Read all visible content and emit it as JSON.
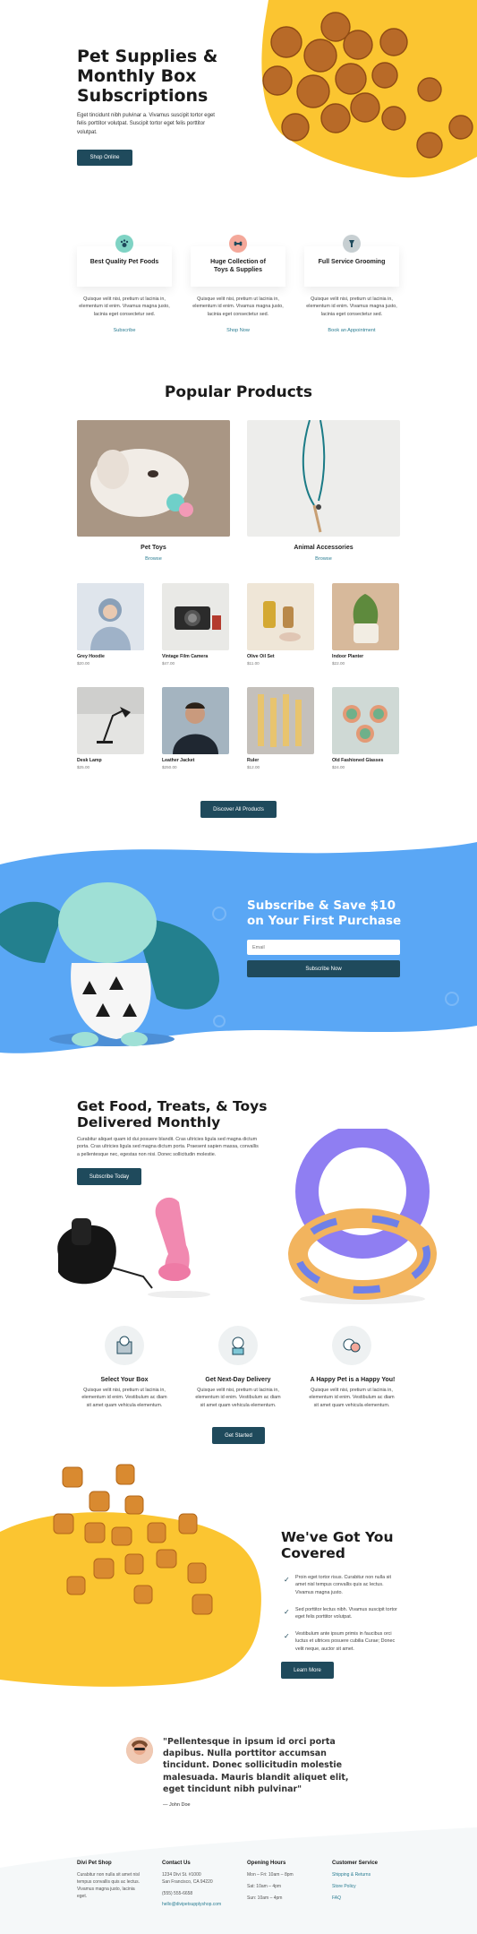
{
  "hero": {
    "title_l1": "Pet Supplies &",
    "title_l2": "Monthly Box",
    "title_l3": "Subscriptions",
    "body": "Eget tincidunt nibh pulvinar a. Vivamus suscipit tortor eget felis porttitor volutpat. Suscipit tortor eget felis porttitor volutpat.",
    "button": "Shop Online"
  },
  "features": [
    {
      "title": "Best Quality Pet Foods",
      "text": "Quisque velit nisi, pretium ut lacinia in, elementum id enim. Vivamus magna justo, lacinia eget consectetur sed.",
      "link": "Subscribe",
      "color": "#7fd3c4",
      "icon": "paw-icon"
    },
    {
      "title": "Huge Collection of Toys & Supplies",
      "text": "Quisque velit nisi, pretium ut lacinia in, elementum id enim. Vivamus magna justo, lacinia eget consectetur sed.",
      "link": "Shop Now",
      "color": "#f4a89a",
      "icon": "bone-icon"
    },
    {
      "title": "Full Service Grooming",
      "text": "Quisque velit nisi, pretium ut lacinia in, elementum id enim. Vivamus magna justo, lacinia eget consectetur sed.",
      "link": "Book an Appointment",
      "color": "#b9c4c8",
      "icon": "scissors-icon"
    }
  ],
  "popular": {
    "title": "Popular Products",
    "cat1": {
      "name": "Pet Toys",
      "link": "Browse"
    },
    "cat2": {
      "name": "Animal Accessories",
      "link": "Browse"
    },
    "button": "Discover All Products"
  },
  "products": [
    {
      "name": "Grey Hoodie",
      "price": "$20.00",
      "color": "#b7c4d6"
    },
    {
      "name": "Vintage Film Camera",
      "price": "$47.00",
      "color": "#d6d6d2"
    },
    {
      "name": "Olive Oil Set",
      "price": "$11.00",
      "color": "#e4c98d"
    },
    {
      "name": "Indoor Planter",
      "price": "$22.00",
      "color": "#a9a56e"
    },
    {
      "name": "Desk Lamp",
      "price": "$25.00",
      "color": "#bfbfbf"
    },
    {
      "name": "Leather Jacket",
      "price": "$250.00",
      "color": "#34404d"
    },
    {
      "name": "Ruler",
      "price": "$12.00",
      "color": "#d9c3a2"
    },
    {
      "name": "Old Fashioned Glasses",
      "price": "$24.00",
      "color": "#c7d4cf"
    }
  ],
  "subscribe": {
    "title_l1": "Subscribe & Save $10",
    "title_l2": "on Your First Purchase",
    "placeholder": "Email",
    "button": "Subscribe Now"
  },
  "monthly": {
    "title_l1": "Get Food, Treats, & Toys",
    "title_l2": "Delivered Monthly",
    "body": "Curabitur aliquet quam id dui posuere blandit. Cras ultricies ligula sed magna dictum porta. Cras ultricies ligula sed magna dictum porta. Praesent sapien massa, convallis a pellentesque nec, egestas non nisi. Donec sollicitudin molestie.",
    "button": "Subscribe Today"
  },
  "steps": [
    {
      "title": "Select Your Box",
      "text": "Quisque velit nisi, pretium ut lacinia in, elementum id enim. Vestibulum ac diam sit amet quam vehicula elementum."
    },
    {
      "title": "Get Next-Day Delivery",
      "text": "Quisque velit nisi, pretium ut lacinia in, elementum id enim. Vestibulum ac diam sit amet quam vehicula elementum."
    },
    {
      "title": "A Happy Pet is a Happy You!",
      "text": "Quisque velit nisi, pretium ut lacinia in, elementum id enim. Vestibulum ac diam sit amet quam vehicula elementum."
    }
  ],
  "steps_button": "Get Started",
  "covered": {
    "title_l1": "We've Got You",
    "title_l2": "Covered",
    "items": [
      "Proin eget tortor risus. Curabitur non nulla sit amet nisl tempus convallis quis ac lectus. Vivamus magna justo.",
      "Sed porttitor lectus nibh. Vivamus suscipit tortor eget felis porttitor volutpat.",
      "Vestibulum ante ipsum primis in faucibus orci luctus et ultrices posuere cubilia Curae; Donec velit neque, auctor sit amet."
    ],
    "button": "Learn More"
  },
  "testimonial": {
    "quote": "\"Pellentesque in ipsum id orci porta dapibus. Nulla porttitor accumsan tincidunt. Donec sollicitudin molestie malesuada. Mauris blandit aliquet elit, eget tincidunt nibh pulvinar\"",
    "author": "— John Doe"
  },
  "footer": {
    "col1": {
      "title": "Divi Pet Shop",
      "text": "Curabitur non nulla sit amet nisl tempus convallis quis ac lectus. Vivamus magna justo, lacinia eget."
    },
    "col2": {
      "title": "Contact Us",
      "l1": "1234 Divi St. #1000",
      "l2": "San Francisco, CA 94220",
      "l3": "(555) 555-6658",
      "l4": "hello@divipetsupplyshop.com"
    },
    "col3": {
      "title": "Opening Hours",
      "l1": "Mon – Fri: 10am – 8pm",
      "l2": "Sat: 10am – 4pm",
      "l3": "Sun: 10am – 4pm"
    },
    "col4": {
      "title": "Customer Service",
      "l1": "Shipping & Returns",
      "l2": "Store Policy",
      "l3": "FAQ"
    }
  },
  "colors": {
    "accent": "#1f4a5c",
    "yellow": "#fbc531",
    "blue": "#5aa7f5",
    "teal_link": "#2a7d92"
  }
}
